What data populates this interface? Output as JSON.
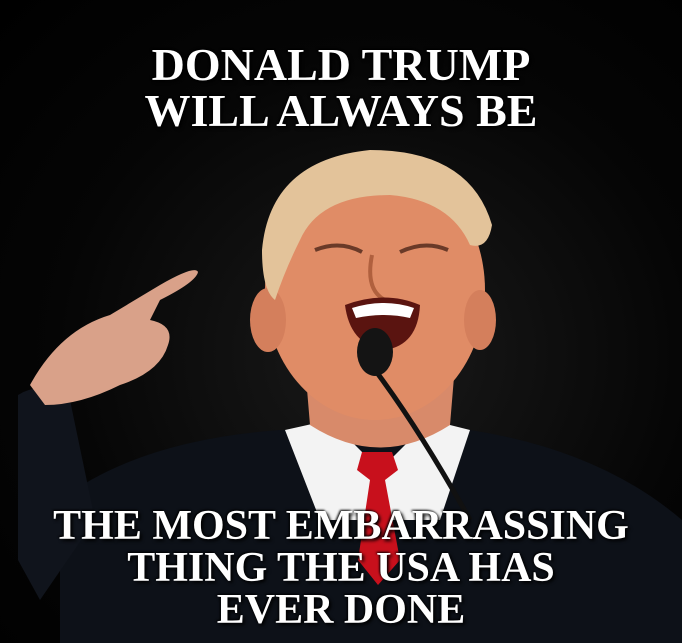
{
  "meme": {
    "top_text": "DONALD TRUMP\nWILL ALWAYS BE",
    "bottom_text": "THE MOST EMBARRASSING\nTHING THE USA HAS\nEVER DONE"
  }
}
